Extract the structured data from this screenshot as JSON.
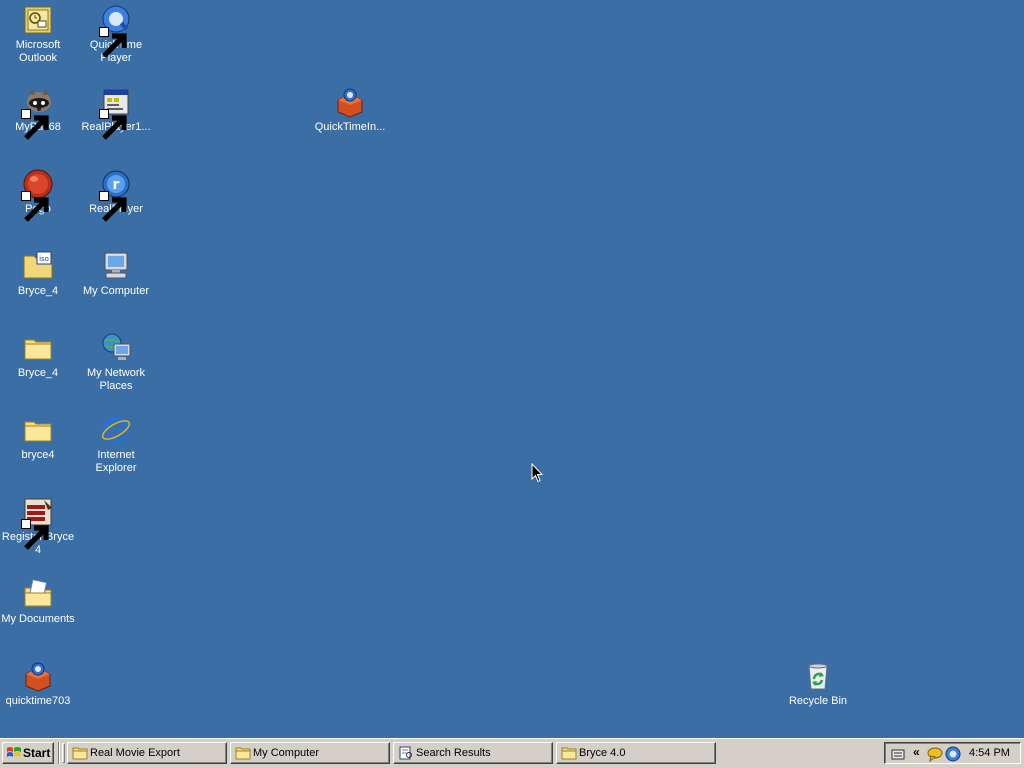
{
  "desktop": {
    "background_color": "#3a6ea5",
    "icons": {
      "outlook": {
        "label": "Microsoft Outlook",
        "icon": "outlook-icon"
      },
      "quicktime_player": {
        "label": "QuickTime Player",
        "icon": "quicktime-icon"
      },
      "mypal": {
        "label": "MyPal 68",
        "icon": "mypal-raccoon-icon"
      },
      "realplayer1": {
        "label": "RealPlayer1...",
        "icon": "installer-icon"
      },
      "quicktime_installer": {
        "label": "QuickTimeIn...",
        "icon": "quicktime-installer-icon"
      },
      "pego": {
        "label": "Pego",
        "icon": "pego-icon"
      },
      "realplayer": {
        "label": "RealPlayer",
        "icon": "realplayer-icon"
      },
      "bryce_iso": {
        "label": "Bryce_4",
        "icon": "iso-file-icon"
      },
      "my_computer": {
        "label": "My Computer",
        "icon": "my-computer-icon"
      },
      "bryce_folder": {
        "label": "Bryce_4",
        "icon": "folder-icon"
      },
      "my_network_places": {
        "label": "My Network Places",
        "icon": "network-icon"
      },
      "bryce4_folder": {
        "label": "bryce4",
        "icon": "folder-icon"
      },
      "internet_explorer": {
        "label": "Internet Explorer",
        "icon": "ie-icon"
      },
      "register_bryce": {
        "label": "Register Bryce 4",
        "icon": "register-icon"
      },
      "my_documents": {
        "label": "My Documents",
        "icon": "my-documents-icon"
      },
      "quicktime703": {
        "label": "quicktime703",
        "icon": "quicktime-installer-icon"
      },
      "recycle_bin": {
        "label": "Recycle Bin",
        "icon": "recycle-bin-icon"
      }
    }
  },
  "taskbar": {
    "start_label": "Start",
    "tasks": [
      {
        "label": "Real Movie Export",
        "icon": "folder-icon"
      },
      {
        "label": "My Computer",
        "icon": "folder-icon"
      },
      {
        "label": "Search Results",
        "icon": "search-results-icon"
      },
      {
        "label": "Bryce 4.0",
        "icon": "folder-icon"
      }
    ],
    "tray": {
      "chevron": "«",
      "clock": "4:54 PM",
      "icons": [
        "keyboard-icon",
        "messenger-icon",
        "quicktime-icon"
      ]
    }
  }
}
